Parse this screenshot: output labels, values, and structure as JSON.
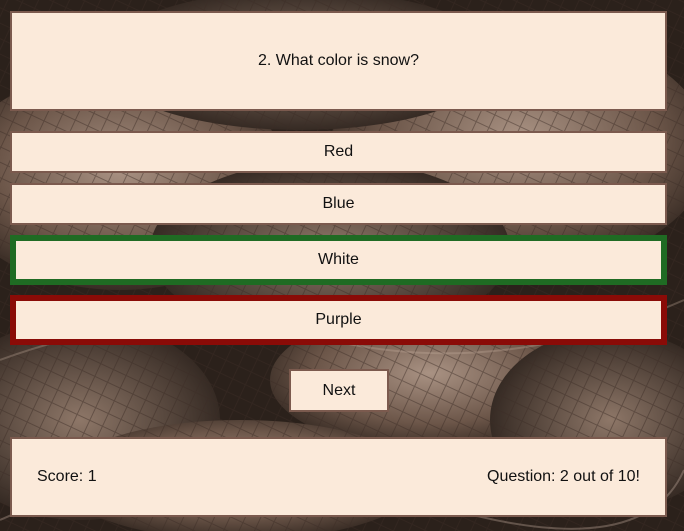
{
  "quiz": {
    "question": "2. What color is snow?",
    "answers": [
      {
        "label": "Red",
        "state": "neutral"
      },
      {
        "label": "Blue",
        "state": "neutral"
      },
      {
        "label": "White",
        "state": "correct"
      },
      {
        "label": "Purple",
        "state": "incorrect"
      }
    ],
    "next_label": "Next"
  },
  "footer": {
    "score_text": "Score: 1",
    "progress_text": "Question: 2 out of 10!"
  },
  "colors": {
    "panel_background": "#fbeada",
    "panel_border": "#7b5a4e",
    "correct_border": "#1f6b23",
    "incorrect_border": "#8a0b07"
  }
}
